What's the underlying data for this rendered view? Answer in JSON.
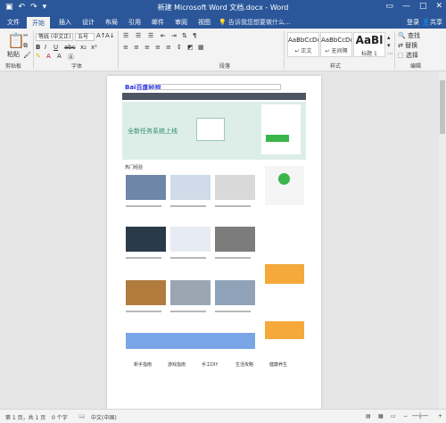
{
  "window": {
    "title": "新建 Microsoft Word 文档.docx - Word"
  },
  "tabs": [
    "文件",
    "开始",
    "插入",
    "设计",
    "布局",
    "引用",
    "邮件",
    "审阅",
    "视图"
  ],
  "tell_me": "告诉我您想要做什么...",
  "login": "登录",
  "share": "共享",
  "ribbon": {
    "clipboard": {
      "paste": "粘贴",
      "label": "剪贴板"
    },
    "font": {
      "name": "等线 (中文正)",
      "size": "五号",
      "label": "字体"
    },
    "paragraph": {
      "label": "段落"
    },
    "styles": {
      "label": "样式",
      "items": [
        {
          "sample": "AaBbCcDc",
          "name": "↵ 正文"
        },
        {
          "sample": "AaBbCcDc",
          "name": "↵ 无间隔"
        },
        {
          "sample": "AaBl",
          "name": "标题 1"
        }
      ]
    },
    "editing": {
      "find": "查找",
      "replace": "替换",
      "select": "选择",
      "label": "编辑"
    }
  },
  "status": {
    "page": "第 1 页，共 1 页",
    "words": "0 个字",
    "lang": "中文(中国)"
  },
  "embedded": {
    "logo": "Bai百度经验",
    "hot_tab": "热门经验",
    "banner_text": "全新任务系统上线",
    "footer_links": [
      "新手指南",
      "游戏指南",
      "手工DIY",
      "生活攻略",
      "健康养生"
    ]
  }
}
